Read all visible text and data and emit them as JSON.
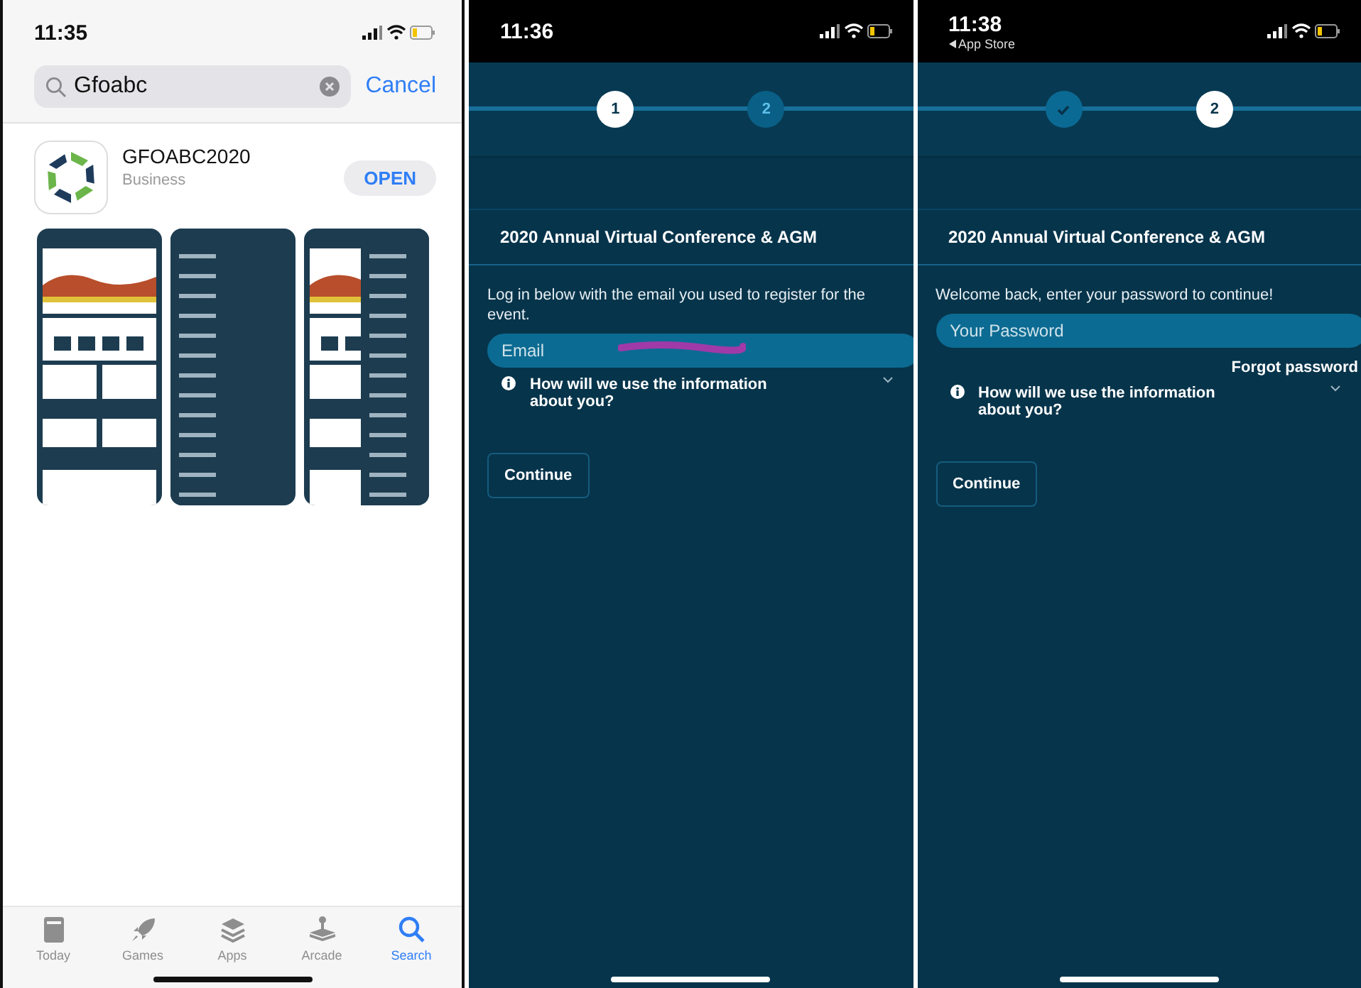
{
  "store": {
    "status": {
      "time": "11:35"
    },
    "search": {
      "value": "Gfoabc",
      "cancel": "Cancel"
    },
    "app": {
      "name": "GFOABC2020",
      "category": "Business",
      "action": "OPEN"
    },
    "tabs": [
      {
        "label": "Today",
        "selected": false
      },
      {
        "label": "Games",
        "selected": false
      },
      {
        "label": "Apps",
        "selected": false
      },
      {
        "label": "Arcade",
        "selected": false
      },
      {
        "label": "Search",
        "selected": true
      }
    ]
  },
  "logins": [
    {
      "status": {
        "time": "11:36"
      },
      "steps": [
        {
          "label": "1",
          "selected": true,
          "done": false
        },
        {
          "label": "2",
          "selected": false,
          "done": false
        }
      ],
      "title": "2020 Annual Virtual Conference & AGM",
      "intro": "Log in below with the email you used to register for the event.",
      "field": {
        "placeholder": "Email",
        "redacted": true
      },
      "info": "How will we use the information about you?",
      "button": "Continue"
    },
    {
      "status": {
        "time": "11:38",
        "back": "App Store"
      },
      "steps": [
        {
          "selected": false,
          "done": true
        },
        {
          "label": "2",
          "selected": true,
          "done": false
        }
      ],
      "title": "2020 Annual Virtual Conference & AGM",
      "intro": "Welcome back, enter your password to continue!",
      "field": {
        "placeholder": "Your Password"
      },
      "link": "Forgot password",
      "info": "How will we use the information about you?",
      "button": "Continue"
    }
  ]
}
